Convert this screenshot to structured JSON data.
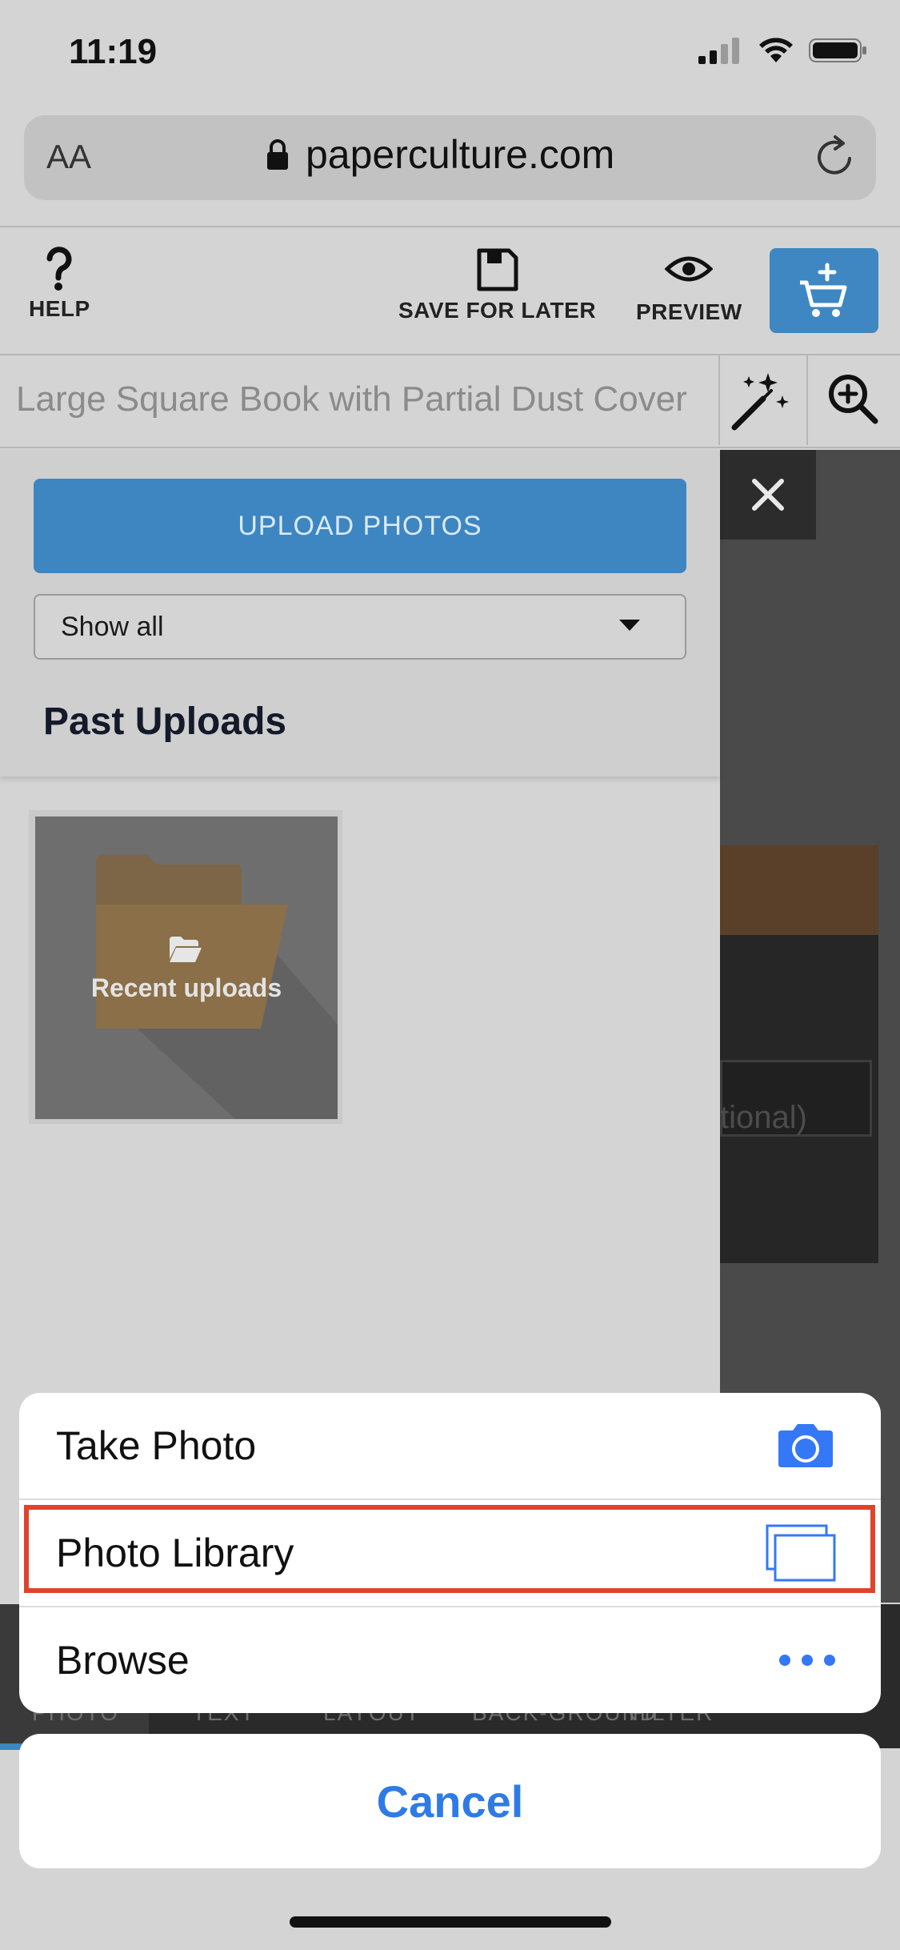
{
  "status_bar": {
    "time": "11:19"
  },
  "browser": {
    "text_size_label": "AA",
    "domain": "paperculture.com"
  },
  "toolbar": {
    "help_label": "HELP",
    "save_label": "SAVE FOR LATER",
    "preview_label": "PREVIEW"
  },
  "editor": {
    "product_title": "Large Square Book with Partial Dust Cover"
  },
  "canvas": {
    "partial_text": "tional)"
  },
  "panel": {
    "upload_label": "UPLOAD PHOTOS",
    "filter_value": "Show all",
    "past_uploads_heading": "Past Uploads",
    "tile_label": "Recent uploads"
  },
  "tabs": [
    "PHOTO",
    "TEXT",
    "LAYOUT",
    "BACK-GROUND",
    "FILTER"
  ],
  "action_sheet": {
    "items": [
      {
        "label": "Take Photo",
        "icon": "camera-icon"
      },
      {
        "label": "Photo Library",
        "icon": "photo-library-icon"
      },
      {
        "label": "Browse",
        "icon": "more-icon"
      }
    ],
    "cancel_label": "Cancel"
  },
  "colors": {
    "accent_blue": "#3d86c1",
    "ios_blue": "#2f7be6",
    "highlight_red": "#e0432c"
  }
}
